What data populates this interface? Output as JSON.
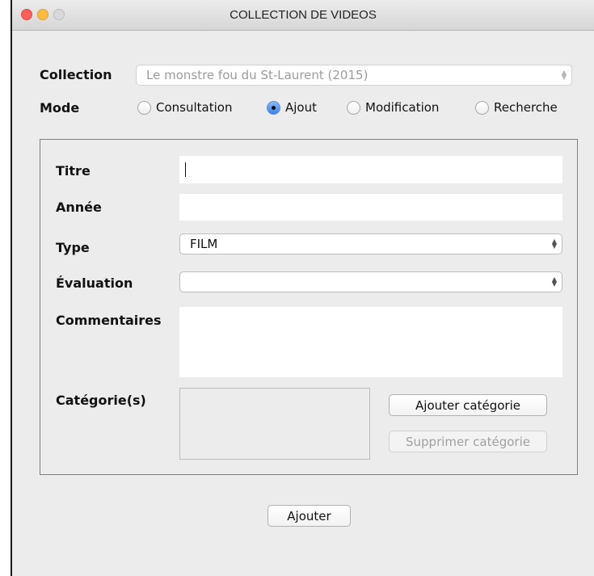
{
  "window": {
    "title": "COLLECTION DE VIDEOS"
  },
  "collection": {
    "label": "Collection",
    "value": "Le monstre fou du St-Laurent (2015)"
  },
  "mode": {
    "label": "Mode",
    "options": [
      {
        "label": "Consultation",
        "checked": false
      },
      {
        "label": "Ajout",
        "checked": true
      },
      {
        "label": "Modification",
        "checked": false
      },
      {
        "label": "Recherche",
        "checked": false
      }
    ]
  },
  "form": {
    "titre": {
      "label": "Titre",
      "value": ""
    },
    "annee": {
      "label": "Année",
      "value": ""
    },
    "type": {
      "label": "Type",
      "value": "FILM"
    },
    "evaluation": {
      "label": "Évaluation",
      "value": ""
    },
    "commentaires": {
      "label": "Commentaires",
      "value": ""
    },
    "categories": {
      "label": "Catégorie(s)",
      "items": []
    },
    "add_category_label": "Ajouter catégorie",
    "remove_category_label": "Supprimer catégorie"
  },
  "submit_label": "Ajouter",
  "colors": {
    "accent": "#3c82ea",
    "close": "#fc605c",
    "minimize": "#fdbc40"
  },
  "icons": {
    "close": "close-icon",
    "minimize": "minimize-icon",
    "zoom": "zoom-icon",
    "select_arrows": "chevron-up-down-icon"
  }
}
